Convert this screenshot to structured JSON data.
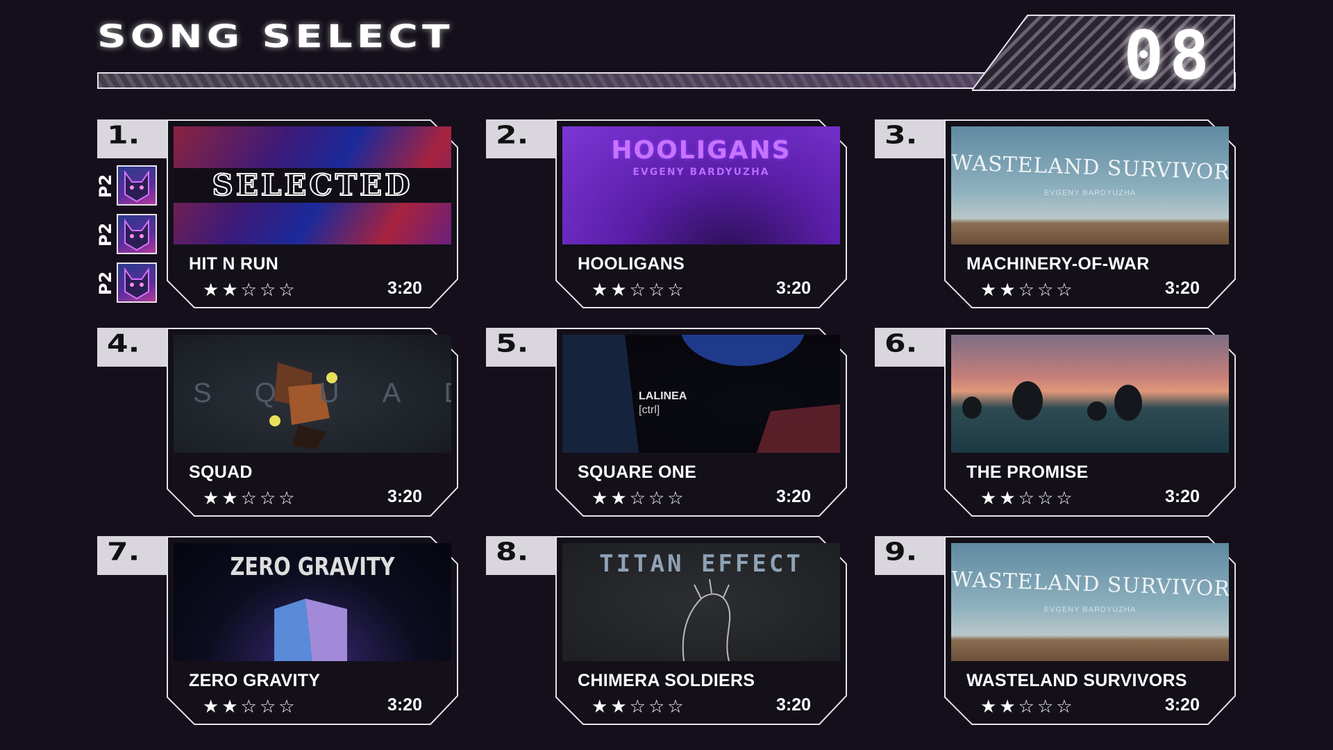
{
  "header": {
    "title": "SONG SELECT",
    "count": "08"
  },
  "players": {
    "labels": [
      "P2",
      "P2",
      "P2"
    ],
    "avatar_icon": "cat-avatar-icon"
  },
  "songs": [
    {
      "number": "1.",
      "title": "HIT N RUN",
      "duration": "3:20",
      "rating": 2,
      "max_rating": 5,
      "selected": true,
      "overlay": "SELECTED",
      "thumb_text": [
        "",
        ""
      ]
    },
    {
      "number": "2.",
      "title": "HOOLIGANS",
      "duration": "3:20",
      "rating": 2,
      "max_rating": 5,
      "selected": false,
      "thumb_text": [
        "HOOLIGANS",
        "EVGENY BARDYUZHA"
      ]
    },
    {
      "number": "3.",
      "title": "MACHINERY-OF-WAR",
      "duration": "3:20",
      "rating": 2,
      "max_rating": 5,
      "selected": false,
      "thumb_text": [
        "WASTELAND SURVIVORS",
        "EVGENY BARDYUZHA"
      ]
    },
    {
      "number": "4.",
      "title": "SQUAD",
      "duration": "3:20",
      "rating": 2,
      "max_rating": 5,
      "selected": false,
      "thumb_text": [
        "SQUAD",
        ""
      ]
    },
    {
      "number": "5.",
      "title": "SQUARE ONE",
      "duration": "3:20",
      "rating": 2,
      "max_rating": 5,
      "selected": false,
      "thumb_text": [
        "LALINEA",
        "[ctrl]"
      ]
    },
    {
      "number": "6.",
      "title": "THE PROMISE",
      "duration": "3:20",
      "rating": 2,
      "max_rating": 5,
      "selected": false,
      "thumb_text": [
        "",
        ""
      ]
    },
    {
      "number": "7.",
      "title": "ZERO GRAVITY",
      "duration": "3:20",
      "rating": 2,
      "max_rating": 5,
      "selected": false,
      "thumb_text": [
        "ZERO GRAVITY",
        ""
      ]
    },
    {
      "number": "8.",
      "title": "CHIMERA SOLDIERS",
      "duration": "3:20",
      "rating": 2,
      "max_rating": 5,
      "selected": false,
      "thumb_text": [
        "TITAN EFFECT",
        ""
      ]
    },
    {
      "number": "9.",
      "title": "WASTELAND SURVIVORS",
      "duration": "3:20",
      "rating": 2,
      "max_rating": 5,
      "selected": false,
      "thumb_text": [
        "WASTELAND SURVIVORS",
        "EVGENY BARDYUZHA"
      ]
    }
  ],
  "colors": {
    "background": "#140f1a",
    "frame": "#e6e2ea",
    "tab": "#d9d6dd",
    "accent": "#7d37d6"
  },
  "icons": {
    "star_filled": "star-filled-icon",
    "star_empty": "star-empty-icon"
  }
}
